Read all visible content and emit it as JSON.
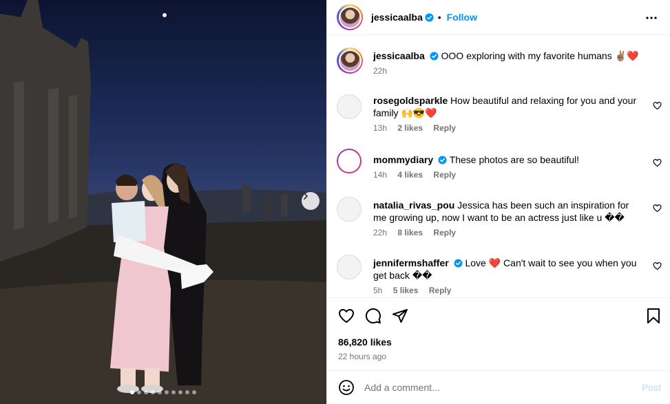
{
  "post": {
    "username": "jessicaalba",
    "follow_label": "Follow",
    "separator": "•",
    "caption": {
      "username": "jessicaalba",
      "text": "OOO exploring with my favorite humans ✌🏽❤️",
      "time": "22h"
    },
    "likes_count": "86,820 likes",
    "time_ago": "22 hours ago",
    "carousel": {
      "total_slides": 10,
      "active_slide": 1
    }
  },
  "comments": [
    {
      "username": "rosegoldsparkle",
      "verified": false,
      "text": "How beautiful and relaxing for you and your family 🙌😎❤️",
      "time": "13h",
      "likes": "2 likes",
      "reply": "Reply"
    },
    {
      "username": "mommydiary",
      "verified": true,
      "text": "These photos are so beautiful!",
      "time": "14h",
      "likes": "4 likes",
      "reply": "Reply"
    },
    {
      "username": "natalia_rivas_pou",
      "verified": false,
      "text": "Jessica has been such an inspiration for me growing up, now I want to be an actress just like u ��",
      "time": "22h",
      "likes": "8 likes",
      "reply": "Reply"
    },
    {
      "username": "jennifermshaffer",
      "verified": true,
      "text": "Love ❤️ Can't wait to see you when you get back ��",
      "time": "5h",
      "likes": "5 likes",
      "reply": "Reply"
    }
  ],
  "add_comment": {
    "placeholder": "Add a comment...",
    "post_label": "Post"
  },
  "colors": {
    "follow_blue": "#0095f6",
    "verified_blue": "#0095f6",
    "like_red": "#ed4956",
    "secondary_text": "#737373"
  },
  "icons": [
    "more-icon",
    "verified-icon",
    "heart-icon",
    "comment-icon",
    "share-icon",
    "bookmark-icon",
    "emoji-icon",
    "chevron-right-icon"
  ]
}
